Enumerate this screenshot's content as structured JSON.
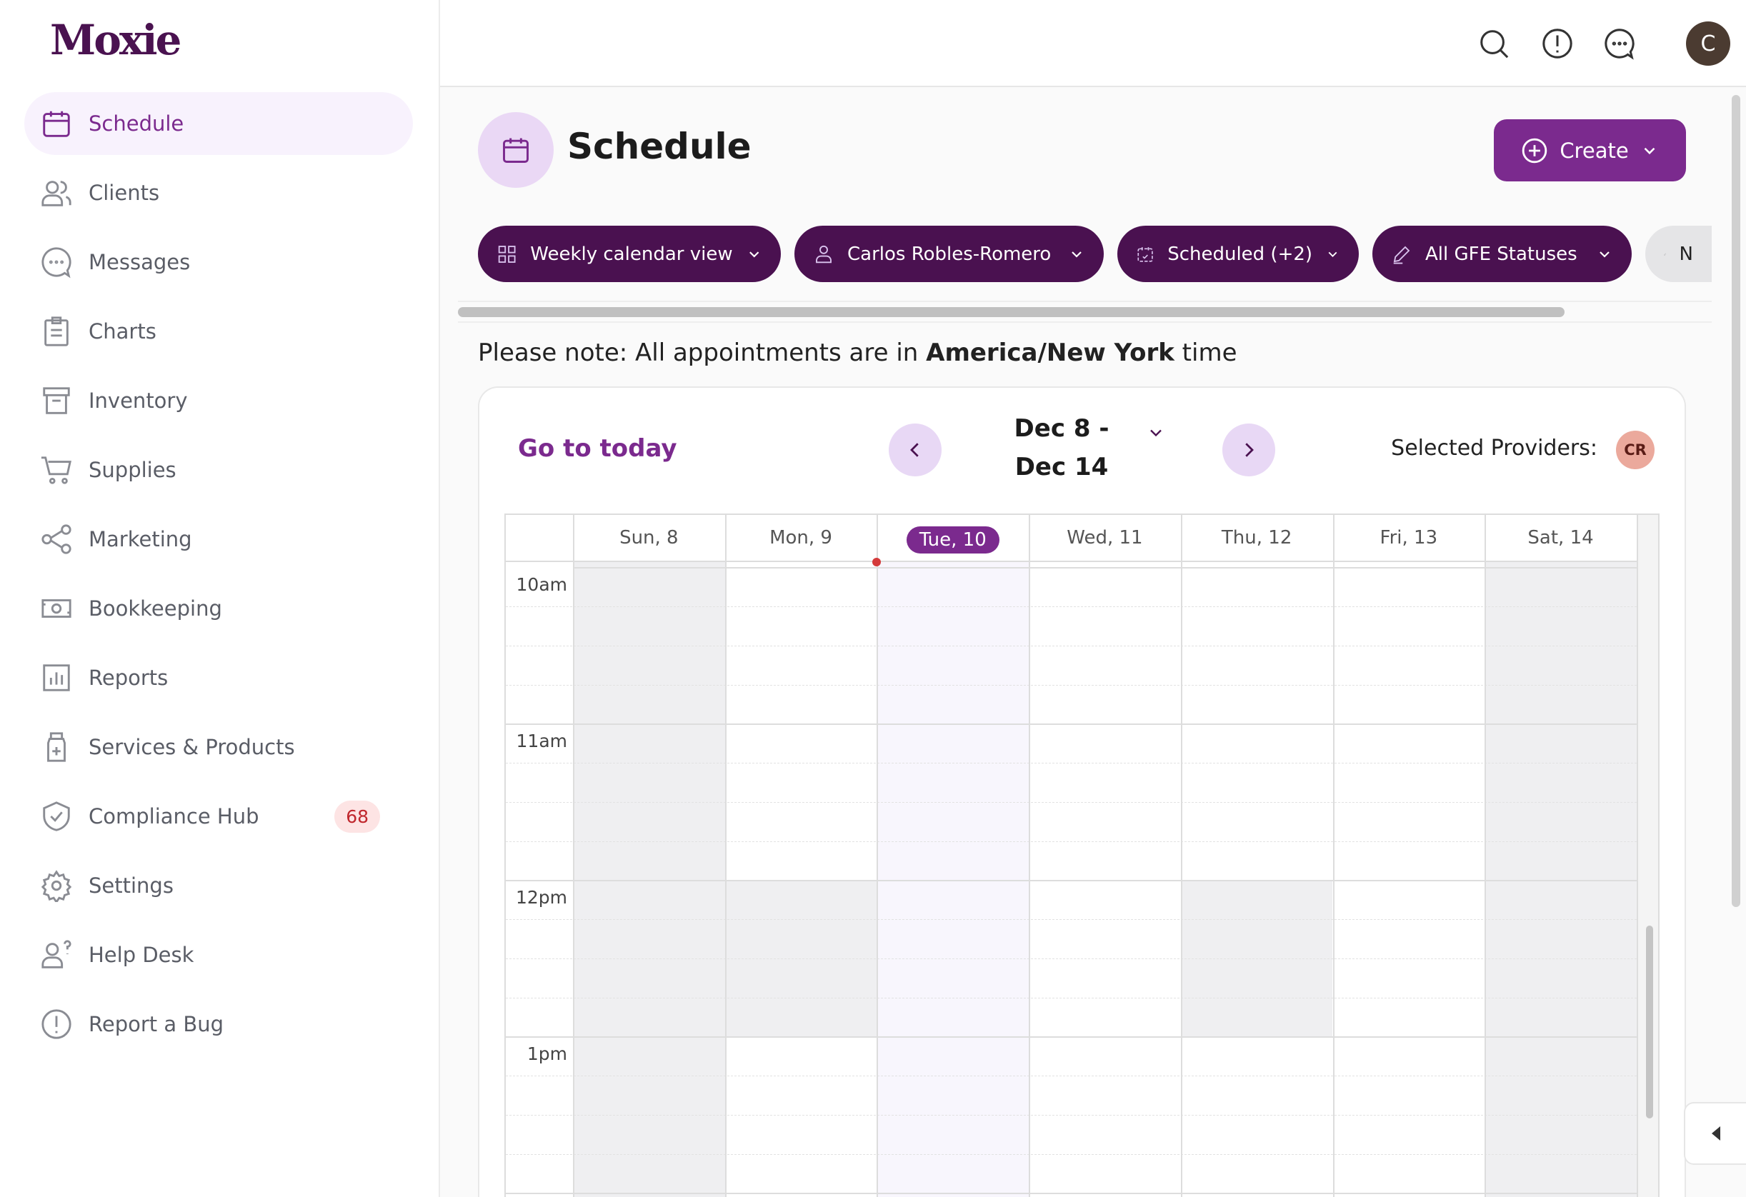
{
  "brand": {
    "logo_text": "Moxie",
    "accent": "#7b2a8e",
    "dark": "#4a1150"
  },
  "sidebar": {
    "items": [
      {
        "label": "Schedule",
        "icon": "calendar-icon",
        "active": true
      },
      {
        "label": "Clients",
        "icon": "users-icon"
      },
      {
        "label": "Messages",
        "icon": "chat-icon"
      },
      {
        "label": "Charts",
        "icon": "clipboard-icon"
      },
      {
        "label": "Inventory",
        "icon": "archive-box-icon"
      },
      {
        "label": "Supplies",
        "icon": "cart-icon"
      },
      {
        "label": "Marketing",
        "icon": "share-icon"
      },
      {
        "label": "Bookkeeping",
        "icon": "cash-icon"
      },
      {
        "label": "Reports",
        "icon": "bar-chart-icon"
      },
      {
        "label": "Services & Products",
        "icon": "bottle-icon"
      },
      {
        "label": "Compliance Hub",
        "icon": "shield-icon",
        "badge": "68"
      },
      {
        "label": "Settings",
        "icon": "gear-icon"
      },
      {
        "label": "Help Desk",
        "icon": "help-user-icon"
      },
      {
        "label": "Report a Bug",
        "icon": "alert-circle-icon"
      }
    ]
  },
  "header": {
    "avatar_initial": "C",
    "icons": [
      "search-icon",
      "alert-icon",
      "chat-icon"
    ]
  },
  "page": {
    "title": "Schedule",
    "create_label": "Create"
  },
  "filters": [
    {
      "label": "Weekly calendar view",
      "icon": "grid-icon"
    },
    {
      "label": "Carlos Robles-Romero",
      "icon": "user-icon"
    },
    {
      "label": "Scheduled (+2)",
      "icon": "calendar-check-icon"
    },
    {
      "label": "All GFE Statuses",
      "icon": "pencil-icon"
    },
    {
      "label": "N",
      "icon": "pencil-icon"
    }
  ],
  "note": {
    "prefix": "Please note: All appointments are in ",
    "tz": "America/New York",
    "suffix": " time"
  },
  "calendar": {
    "go_today": "Go to today",
    "range_line1": "Dec 8 -",
    "range_line2": "Dec 14",
    "selected_providers_label": "Selected Providers:",
    "provider_initials": "CR",
    "days": [
      "Sun, 8",
      "Mon, 9",
      "Tue, 10",
      "Wed, 11",
      "Thu, 12",
      "Fri, 13",
      "Sat, 14"
    ],
    "today_index": 2,
    "hours": [
      "10am",
      "11am",
      "12pm",
      "1pm"
    ],
    "unavailable": [
      {
        "day": 0,
        "all": true
      },
      {
        "day": 6,
        "all": true
      },
      {
        "day": 1,
        "hour": "12pm"
      },
      {
        "day": 4,
        "hour": "12pm"
      }
    ]
  }
}
